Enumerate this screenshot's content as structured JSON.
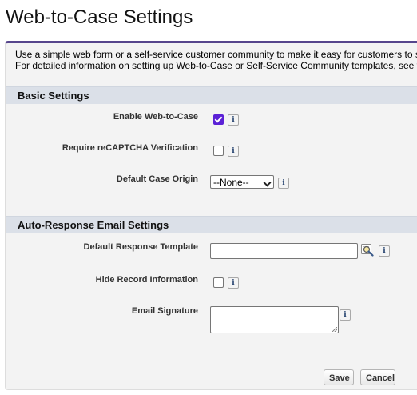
{
  "page": {
    "title": "Web-to-Case Settings"
  },
  "intro": {
    "line1": "Use a simple web form or a self-service customer community to make it easy for customers to s",
    "line2": "For detailed information on setting up Web-to-Case or Self-Service Community templates, see t"
  },
  "basic_settings": {
    "header": "Basic Settings",
    "enable_web_to_case": {
      "label": "Enable Web-to-Case",
      "checked": true
    },
    "require_recaptcha": {
      "label": "Require reCAPTCHA Verification",
      "checked": false
    },
    "default_case_origin": {
      "label": "Default Case Origin",
      "selected": "--None--"
    }
  },
  "auto_response": {
    "header": "Auto-Response Email Settings",
    "default_response_template": {
      "label": "Default Response Template",
      "value": ""
    },
    "hide_record_information": {
      "label": "Hide Record Information",
      "checked": false
    },
    "email_signature": {
      "label": "Email Signature",
      "value": ""
    }
  },
  "buttons": {
    "save": "Save",
    "cancel": "Cancel"
  },
  "icons": {
    "info": "i",
    "accent_color": "#5b21d6",
    "header_border_color": "#56458c"
  }
}
